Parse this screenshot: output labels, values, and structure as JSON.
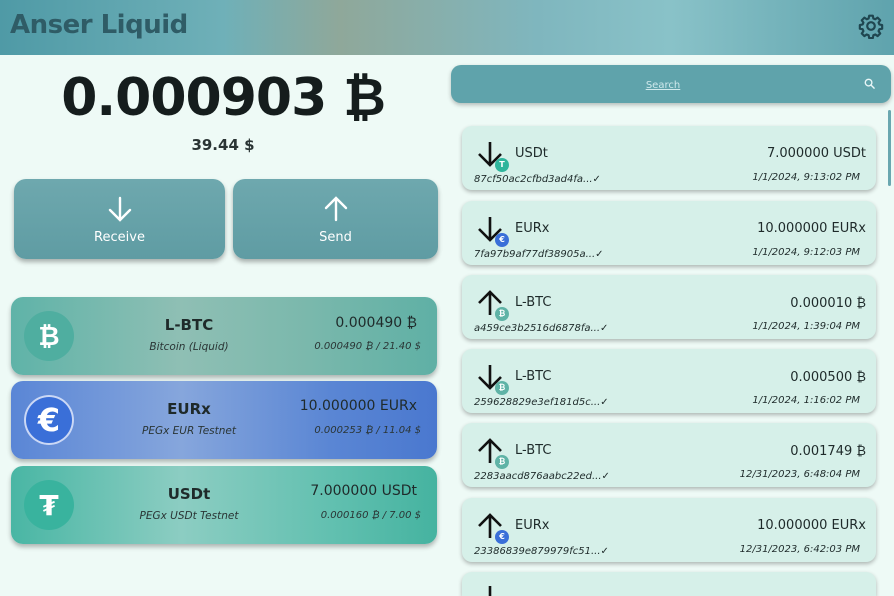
{
  "header": {
    "title": "Anser Liquid",
    "settings_icon": "gear-icon"
  },
  "wallet": {
    "balance": "0.000903 ₿",
    "fiat": "39.44 $",
    "receive_label": "Receive",
    "send_label": "Send"
  },
  "assets": [
    {
      "ticker": "L-BTC",
      "name": "Bitcoin (Liquid)",
      "amount": "0.000490 ₿",
      "value": "0.000490 ₿  /  21.40 $",
      "icon": "bitcoin-icon",
      "color": "#4fb0a2"
    },
    {
      "ticker": "EURx",
      "name": "PEGx EUR Testnet",
      "amount": "10.000000 EURx",
      "value": "0.000253 ₿  /  11.04 $",
      "icon": "euro-icon",
      "color": "#3a6fd8"
    },
    {
      "ticker": "USDt",
      "name": "PEGx USDt Testnet",
      "amount": "7.000000 USDt",
      "value": "0.000160 ₿  /  7.00 $",
      "icon": "tether-icon",
      "color": "#3bb4a0"
    }
  ],
  "search": {
    "placeholder": "Search"
  },
  "transactions": [
    {
      "direction": "in",
      "asset": "USDt",
      "amount": "7.000000 USDt",
      "hash": "87cf50ac2cfbd3ad4fa...✓",
      "date": "1/1/2024, 9:13:02 PM",
      "badge": "T",
      "badge_color": "#2fb59c"
    },
    {
      "direction": "in",
      "asset": "EURx",
      "amount": "10.000000 EURx",
      "hash": "7fa97b9af77df38905a...✓",
      "date": "1/1/2024, 9:12:03 PM",
      "badge": "€",
      "badge_color": "#3a6fd8"
    },
    {
      "direction": "out",
      "asset": "L-BTC",
      "amount": "0.000010 ₿",
      "hash": "a459ce3b2516d6878fa...✓",
      "date": "1/1/2024, 1:39:04 PM",
      "badge": "₿",
      "badge_color": "#5fb3a6"
    },
    {
      "direction": "in",
      "asset": "L-BTC",
      "amount": "0.000500 ₿",
      "hash": "259628829e3ef181d5c...✓",
      "date": "1/1/2024, 1:16:02 PM",
      "badge": "₿",
      "badge_color": "#5fb3a6"
    },
    {
      "direction": "out",
      "asset": "L-BTC",
      "amount": "0.001749 ₿",
      "hash": "2283aacd876aabc22ed...✓",
      "date": "12/31/2023, 6:48:04 PM",
      "badge": "₿",
      "badge_color": "#5fb3a6"
    },
    {
      "direction": "out",
      "asset": "EURx",
      "amount": "10.000000 EURx",
      "hash": "23386839e879979fc51...✓",
      "date": "12/31/2023, 6:42:03 PM",
      "badge": "€",
      "badge_color": "#3a6fd8"
    }
  ]
}
